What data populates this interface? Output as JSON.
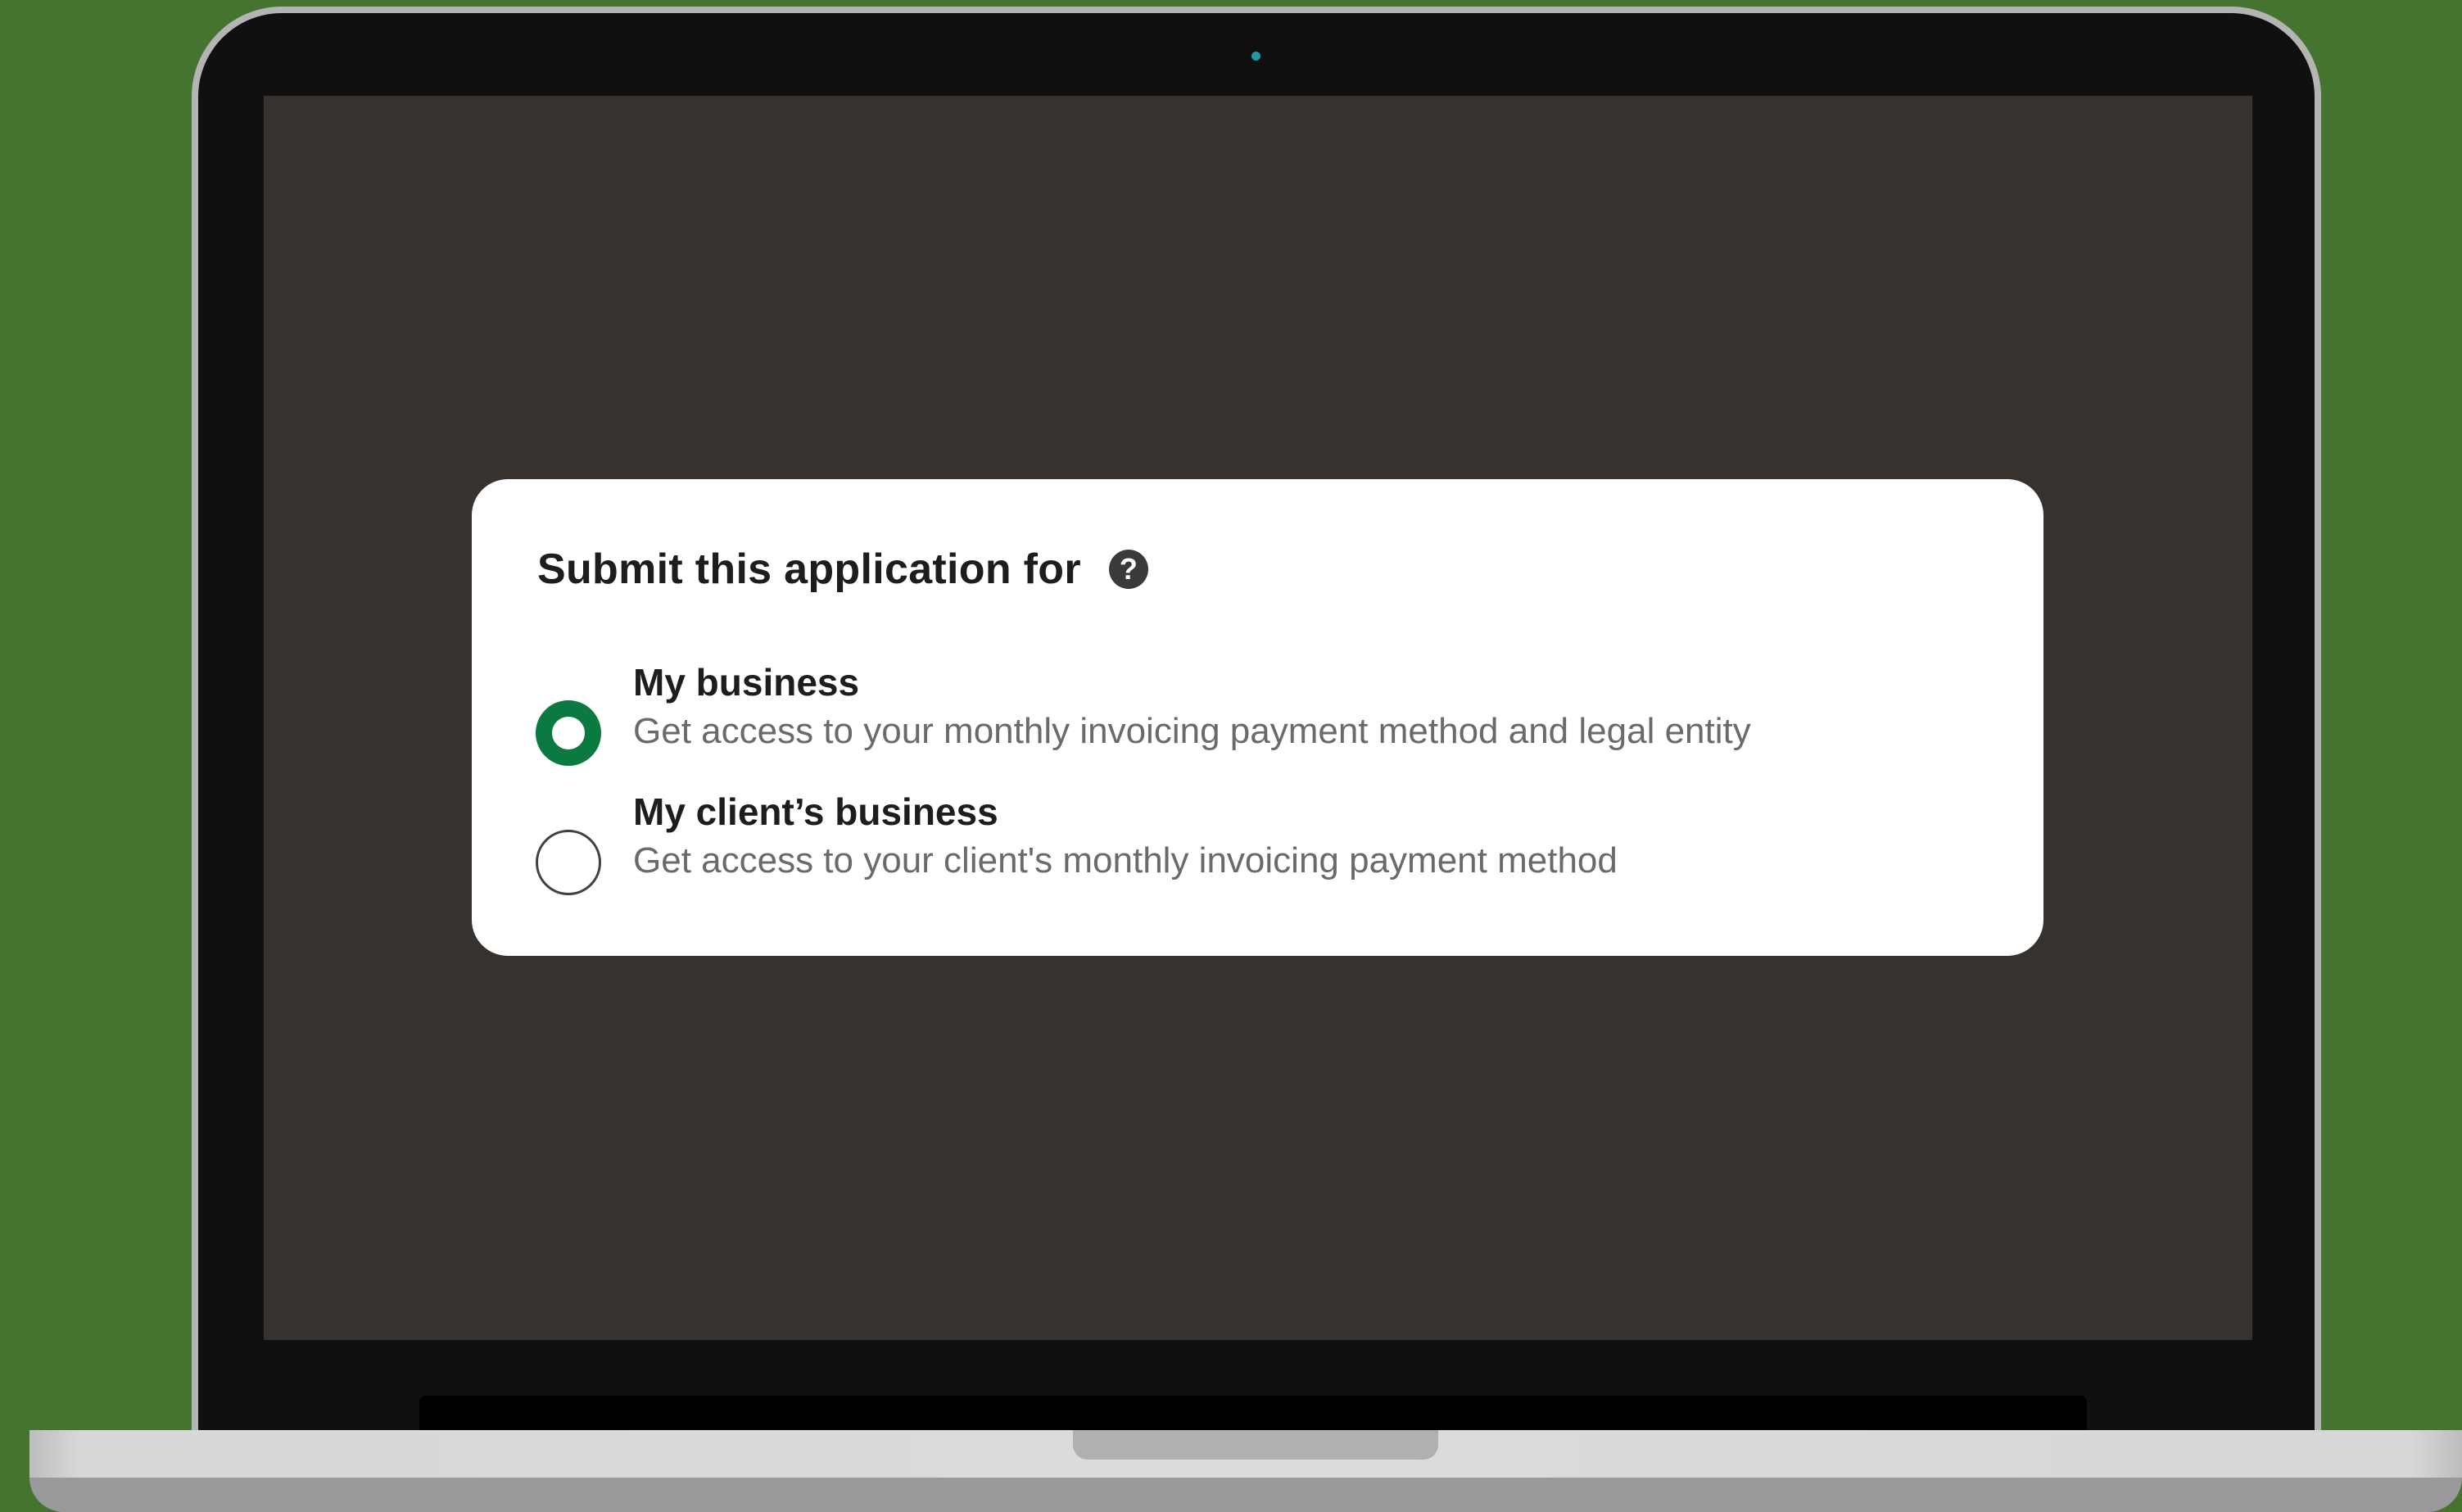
{
  "dialog": {
    "title": "Submit this application for",
    "help_icon": "question-circle-icon",
    "options": [
      {
        "label": "My business",
        "description": "Get access to your monthly invoicing payment method and legal entity",
        "selected": true
      },
      {
        "label": "My client’s business",
        "description": "Get access to your client's monthly invoicing payment method",
        "selected": false
      }
    ]
  },
  "colors": {
    "background": "#457431",
    "screen": "#37322d",
    "accent": "#0b7a40"
  }
}
